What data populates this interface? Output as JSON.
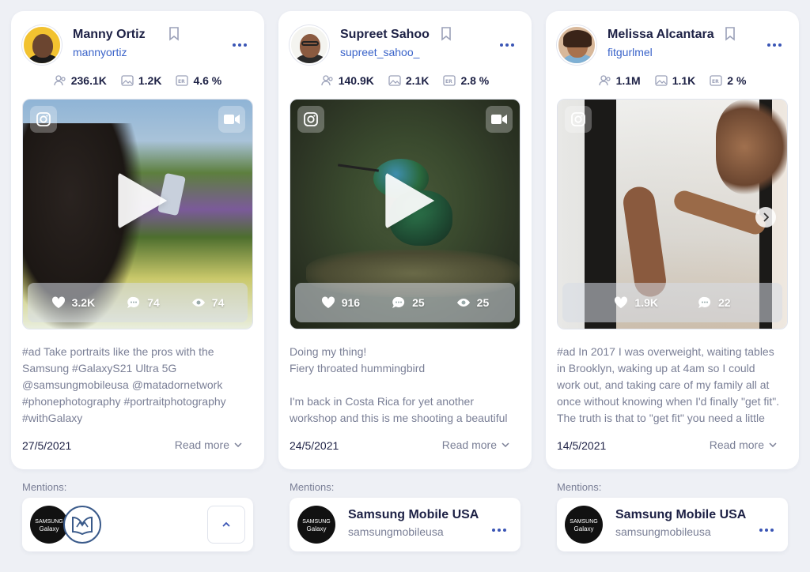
{
  "colors": {
    "accent": "#3a55b5",
    "handle": "#3a63c9",
    "text_dark": "#1d2145",
    "text_muted": "#7a7f96",
    "background": "#eef0f5"
  },
  "cards": [
    {
      "name": "Manny Ortiz",
      "handle": "mannyortiz",
      "followers": "236.1K",
      "posts": "1.2K",
      "er": "4.6 %",
      "likes": "3.2K",
      "comments": "74",
      "views": "74",
      "media_type": "video",
      "caption": "#ad Take portraits like the pros with the Samsung #GalaxyS21 Ultra 5G @samsungmobileusa @matadornetwork #phonephotography #portraitphotography #withGalaxy",
      "date": "27/5/2021",
      "read_more": "Read more",
      "mentions_label": "Mentions:",
      "mention_logo_line1": "SAMSUNG",
      "mention_logo_line2": "Galaxy"
    },
    {
      "name": "Supreet Sahoo",
      "handle": "supreet_sahoo_",
      "followers": "140.9K",
      "posts": "2.1K",
      "er": "2.8 %",
      "likes": "916",
      "comments": "25",
      "views": "25",
      "media_type": "video",
      "caption": "Doing my thing!\nFiery throated hummingbird\n\nI'm back in Costa Rica for yet another workshop and this is me shooting a beautiful",
      "date": "24/5/2021",
      "read_more": "Read more",
      "mentions_label": "Mentions:",
      "mention_logo_line1": "SAMSUNG",
      "mention_logo_line2": "Galaxy",
      "mention_name": "Samsung Mobile USA",
      "mention_handle": "samsungmobileusa"
    },
    {
      "name": "Melissa Alcantara",
      "handle": "fitgurlmel",
      "followers": "1.1M",
      "posts": "1.1K",
      "er": "2 %",
      "likes": "1.9K",
      "comments": "22",
      "media_type": "carousel",
      "caption": "#ad In 2017 I was overweight, waiting tables in Brooklyn, waking up at 4am so I could work out, and taking care of my family all at once without knowing when I'd finally \"get fit\". The truth is that to \"get fit\" you need a little",
      "date": "14/5/2021",
      "read_more": "Read more",
      "mentions_label": "Mentions:",
      "mention_logo_line1": "SAMSUNG",
      "mention_logo_line2": "Galaxy",
      "mention_name": "Samsung Mobile USA",
      "mention_handle": "samsungmobileusa"
    }
  ]
}
